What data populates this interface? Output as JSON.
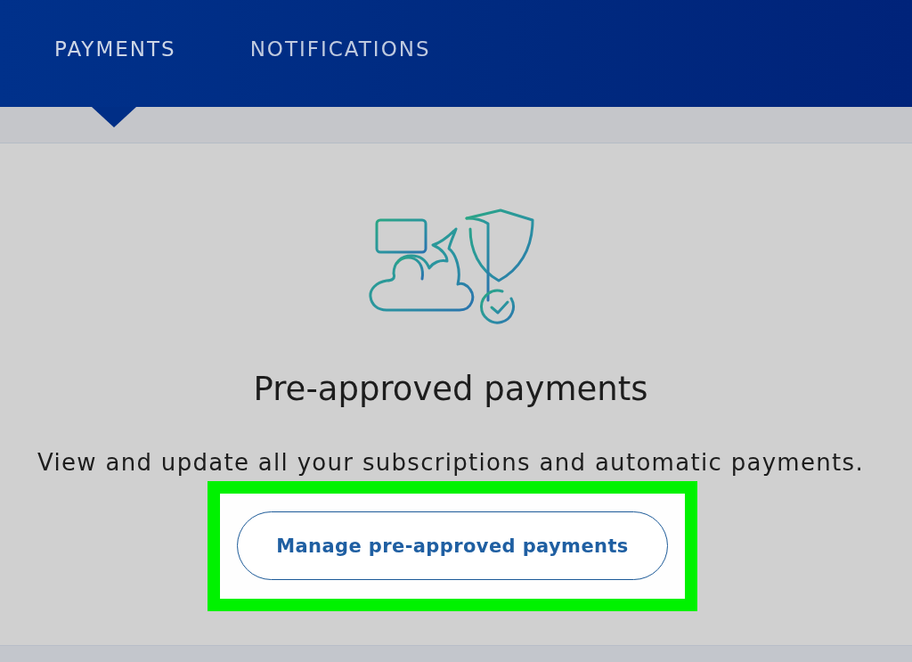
{
  "tabs": [
    {
      "label": "PAYMENTS",
      "selected": true
    },
    {
      "label": "NOTIFICATIONS",
      "selected": false
    }
  ],
  "panel": {
    "title": "Pre-approved payments",
    "description": "View and update all your subscriptions and automatic payments.",
    "button": {
      "label": "Manage pre-approved payments",
      "highlighted": true
    }
  }
}
